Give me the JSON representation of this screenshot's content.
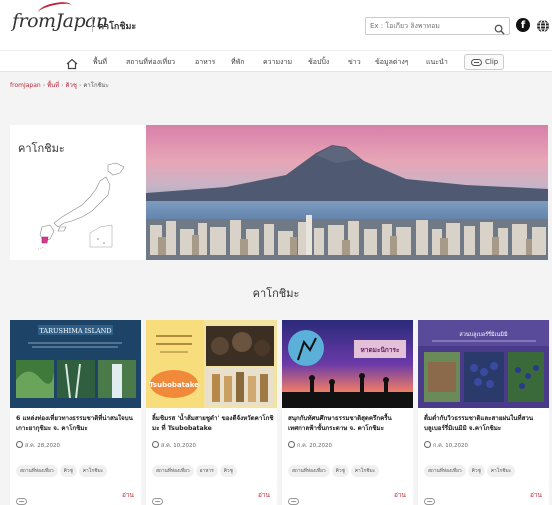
{
  "header": {
    "logo": "fromJapan",
    "title": "คาโกชิมะ",
    "search_placeholder": "Ex : โอเกียว ลิงพาทอม"
  },
  "nav": {
    "items": [
      "พื้นที่",
      "สถานที่ท่องเที่ยว",
      "อาหาร",
      "ที่พัก",
      "ความงาม",
      "ช้อปปิ้ง",
      "ข่าว",
      "ข้อมูลต่างๆ",
      "แนะนำ"
    ],
    "clip_label": "Clip"
  },
  "breadcrumb": {
    "items": [
      "fromJapan",
      "พื้นที่",
      "คิวชู",
      "คาโกชิมะ"
    ]
  },
  "hero": {
    "map_title": "คาโกชิมะ"
  },
  "section_title": "คาโกชิมะ",
  "cards": [
    {
      "image_caption": "TARUSHIMA ISLAND",
      "title": "6 แหล่งท่องเที่ยวทางธรรมชาติที่น่าสนใจบนเกาะยากุชิมะ จ. คาโกชิมะ",
      "date": "ส.ค. 28,2020",
      "tags": [
        "สถานที่ท่องเที่ยว",
        "คิวชู",
        "คาโกชิมะ"
      ],
      "read_label": "อ่าน"
    },
    {
      "image_caption": "Tsubobatake",
      "title": "ลิ้มชิมรส 'น้ำส้มสายชูดำ' ของดีจังหวัดคาโกชิมะ ที่ Tsubobatake",
      "date": "ส.ค. 10,2020",
      "tags": [
        "สถานที่ท่องเที่ยว",
        "อาหาร",
        "คิวชู"
      ],
      "read_label": "อ่าน"
    },
    {
      "image_caption": "หาดมะนิการะ",
      "title": "สนุกกับทัศนศึกษาธรรมชาติสุดครึกครื้นเทศกาลฟ้าชั้นกระดาษ จ. คาโกชิมะ",
      "date": "ก.ค. 20,2020",
      "tags": [
        "สถานที่ท่องเที่ยว",
        "คิวชู",
        "คาโกชิมะ"
      ],
      "read_label": "อ่าน"
    },
    {
      "image_caption": "สวนบลูเบอร์รี่มิเนมิมิ",
      "title": "ดื่มด่ำกับวิวธรรมชาติและสายฝนในที่สวนบลูเบอร์รี่มิเนมิมิ จ.คาโกชิมะ",
      "date": "ก.ค. 10,2020",
      "tags": [
        "สถานที่ท่องเที่ยว",
        "คิวชู",
        "คาโกชิมะ"
      ],
      "read_label": "อ่าน"
    }
  ],
  "colors": {
    "accent": "#c0283a",
    "background": "#f4f4f4"
  }
}
